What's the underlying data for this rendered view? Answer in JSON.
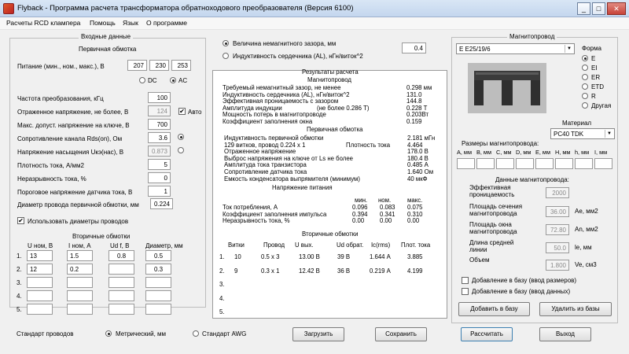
{
  "window": {
    "title": "Flyback - Программа расчета трансформатора обратноходового преобразователя (Версия 6100)",
    "min": "_",
    "max": "□",
    "close": "✕"
  },
  "menu": [
    "Расчеты RCD клампера",
    "Помощь",
    "Язык",
    "О программе"
  ],
  "input": {
    "group": "Входные данные",
    "primary": "Первичная обмотка",
    "supply_label": "Питание (мин., ном., макс.), В",
    "supply": [
      "207",
      "230",
      "253"
    ],
    "dc": "DC",
    "ac": "AC",
    "rows": [
      {
        "label": "Частота преобразования, кГц",
        "value": "100"
      },
      {
        "label": "Отраженное напряжение, не более, В",
        "value": "124",
        "auto": "Авто"
      },
      {
        "label": "Макс. допуст. напряжение на ключе, В",
        "value": "700"
      },
      {
        "label": "Сопротивление канала Rds(on), Ом",
        "value": "3.6"
      },
      {
        "label": "Напряжение насыщения Uкэ(нас), В",
        "value": "0.873"
      },
      {
        "label": "Плотность тока, А/мм2",
        "value": "5"
      },
      {
        "label": "Неразрывность тока, %",
        "value": "0"
      },
      {
        "label": "Пороговое напряжение датчика тока, В",
        "value": "1"
      },
      {
        "label": "Диаметр провода первичной обмотки, мм",
        "value": "0.224"
      }
    ],
    "use_diameters": "Использовать диаметры проводов",
    "secondary": "Вторичные обмотки",
    "sec_headers": [
      "U ном, В",
      "I ном, А",
      "Ud f, В",
      "Диаметр, мм"
    ],
    "sec_rows": [
      {
        "n": "1.",
        "u": "13",
        "i": "1.5",
        "ud": "0.8",
        "d": "0.5"
      },
      {
        "n": "2.",
        "u": "12",
        "i": "0.2",
        "ud": "",
        "d": "0.3"
      },
      {
        "n": "3.",
        "u": "",
        "i": "",
        "ud": "",
        "d": ""
      },
      {
        "n": "4.",
        "u": "",
        "i": "",
        "ud": "",
        "d": ""
      },
      {
        "n": "5.",
        "u": "",
        "i": "",
        "ud": "",
        "d": ""
      }
    ]
  },
  "gap": {
    "opt1": "Величина немагнитного зазора, мм",
    "opt2": "Индуктивность сердечника (AL), нГн/виток^2",
    "value": "0.4"
  },
  "results": {
    "title": "Результаты расчета",
    "core_head": "Магнитопровод",
    "core_rows": [
      {
        "l": "Требуемый немагнитный зазор, не менее",
        "v": "0.298 мм"
      },
      {
        "l": "Индуктивность сердечника (AL), нГн/виток^2",
        "v": "131.0"
      },
      {
        "l": "Эффективная проницаемость с зазором",
        "v": "144.8"
      },
      {
        "l": "Амплитуда индукции",
        "m": "(не более 0.286 Т)",
        "v": "0.228 Т"
      },
      {
        "l": "Мощность потерь в магнитопроводе",
        "v": "0.203Вт"
      },
      {
        "l": "Коэффициент заполнения окна",
        "v": "0.159"
      }
    ],
    "prim_head": "Первичная обмотка",
    "prim_rows": [
      {
        "l": "Индуктивность первичной обмотки",
        "v": "2.181 мГн"
      },
      {
        "l": "129 витков, провод 0.224 x 1",
        "m": "Плотность тока",
        "v": "4.464"
      },
      {
        "l": "Отраженное напряжение",
        "v": "178.0 В"
      },
      {
        "l": "Выброс напряжения на ключе от Ls не более",
        "v": "180.4 В"
      },
      {
        "l": "Амплитуда тока транзистора",
        "v": "0.485 А"
      },
      {
        "l": "Сопротивление датчика тока",
        "v": "1.640 Ом"
      },
      {
        "l": "Емкость конденсатора выпрямителя (минимум)",
        "v": "40 мкФ"
      }
    ],
    "volt_head": "Напряжение питания",
    "vh": [
      "мин.",
      "ном.",
      "макс."
    ],
    "volt_rows": [
      {
        "l": "Ток потребления, А",
        "a": "0.096",
        "b": "0.083",
        "c": "0.075"
      },
      {
        "l": "Коэффициент заполнения импульса",
        "a": "0.394",
        "b": "0.341",
        "c": "0.310"
      },
      {
        "l": "Неразрывность тока, %",
        "a": "0.00",
        "b": "0.00",
        "c": "0.00"
      }
    ],
    "sec_head": "Вторичные обмотки",
    "sh": [
      "Витки",
      "Провод",
      "U вых.",
      "Ud обрат.",
      "Ic(rms)",
      "Плот. тока"
    ],
    "sec_rows": [
      {
        "n": "1.",
        "w": "10",
        "p": "0.5 x 3",
        "u": "13.00 В",
        "ud": "39 В",
        "ic": "1.644 А",
        "j": "3.885"
      },
      {
        "n": "2.",
        "w": "9",
        "p": "0.3 x 1",
        "u": "12.42 В",
        "ud": "36 В",
        "ic": "0.219 А",
        "j": "4.199"
      },
      {
        "n": "3."
      },
      {
        "n": "4."
      },
      {
        "n": "5."
      }
    ]
  },
  "core": {
    "group": "Магнитопровод",
    "selected": "E E25/19/6",
    "shape_label": "Форма",
    "shapes": [
      "E",
      "EI",
      "ER",
      "ETD",
      "R",
      "Другая"
    ],
    "material_label": "Материал",
    "material": "PC40 TDK",
    "dims_label": "Размеры магнитопровода:",
    "dims": [
      "A, мм",
      "B, мм",
      "C, мм",
      "D, мм",
      "E, мм",
      "H, мм",
      "h, мм",
      "I, мм"
    ],
    "data_label": "Данные магнитопровода:",
    "data": [
      {
        "l": "Эффективная проницаемость",
        "v": "2000",
        "u": ""
      },
      {
        "l": "Площадь сечения магнитопровода",
        "v": "36.00",
        "u": "Ае, мм2"
      },
      {
        "l": "Площадь окна магнитопровода",
        "v": "72.80",
        "u": "An, мм2"
      },
      {
        "l": "Длина средней линии",
        "v": "50.0",
        "u": "le, мм"
      },
      {
        "l": "Объем",
        "v": "1.800",
        "u": "Ve, см3"
      }
    ],
    "add_dims": "Добавление в базу (ввод размеров)",
    "add_data": "Добавление в базу (ввод данных)",
    "add_btn": "Добавить в базу",
    "del_btn": "Удалить из базы"
  },
  "bottom": {
    "std": "Стандарт проводов",
    "metric": "Метрический, мм",
    "awg": "Стандарт AWG",
    "load": "Загрузить",
    "save": "Сохранить",
    "calc": "Рассчитать",
    "exit": "Выход"
  },
  "colors": {
    "titlebar": "#c4d6ee",
    "panel": "#f0f0f0",
    "close": "#c7443a"
  }
}
